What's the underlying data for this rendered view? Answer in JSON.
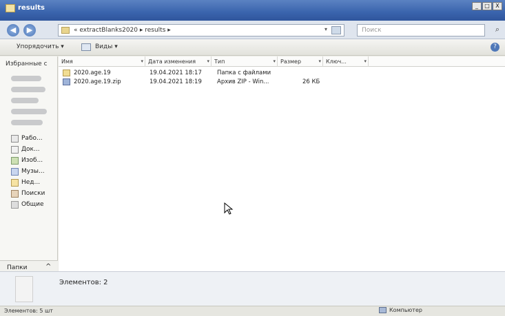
{
  "window": {
    "title": "results",
    "controls": [
      "_",
      "□",
      "X"
    ]
  },
  "address": {
    "back_icon": "back-arrow-icon",
    "forward_icon": "forward-arrow-icon",
    "path": "« extractBlanks2020 ▸ results ▸",
    "search_placeholder": "Поиск"
  },
  "toolbar": {
    "organize_label": "Упорядочить ▾",
    "views_label": "Виды ▾"
  },
  "sidebar": {
    "favorites_title": "Избранные с",
    "items": [
      {
        "label": "Рабо...",
        "icon": "desktop-icon"
      },
      {
        "label": "Док...",
        "icon": "documents-icon"
      },
      {
        "label": "Изоб...",
        "icon": "pictures-icon"
      },
      {
        "label": "Музы...",
        "icon": "music-icon"
      },
      {
        "label": "Нед...",
        "icon": "recent-icon"
      },
      {
        "label": "Поиски",
        "icon": "searches-icon"
      },
      {
        "label": "Общие",
        "icon": "public-icon"
      }
    ],
    "folders_label": "Папки",
    "folders_chevron": "^"
  },
  "columns": [
    {
      "label": "Имя"
    },
    {
      "label": "Дата изменения"
    },
    {
      "label": "Тип"
    },
    {
      "label": "Размер"
    },
    {
      "label": "Ключ..."
    }
  ],
  "files": [
    {
      "name": "2020.age.19",
      "date": "19.04.2021 18:17",
      "type": "Папка с файлами",
      "size": "",
      "icon": "folder"
    },
    {
      "name": "2020.age.19.zip",
      "date": "19.04.2021 18:19",
      "type": "Архив ZIP - Win...",
      "size": "26 КБ",
      "icon": "zip"
    }
  ],
  "details": {
    "count_text": "Элементов: 2"
  },
  "status": {
    "left": "Элементов: 5 шт",
    "right": "Компьютер"
  }
}
